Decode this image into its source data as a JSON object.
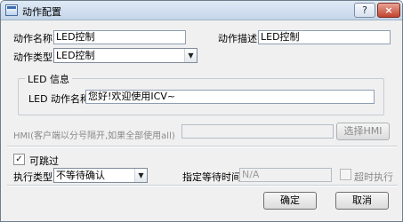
{
  "window": {
    "title": "动作配置",
    "help_label": "?",
    "close_label": "×"
  },
  "form": {
    "action_name_label": "动作名称",
    "action_name_value": "LED控制",
    "action_desc_label": "动作描述",
    "action_desc_value": "LED控制",
    "action_type_label": "动作类型",
    "action_type_value": "LED控制"
  },
  "led_group": {
    "title": "LED 信息",
    "name_label": "LED 动作名称",
    "name_value": "您好!欢迎使用ICV~"
  },
  "hmi": {
    "label": "HMI(客户端以分号隔开,如果全部使用all)",
    "value": "",
    "select_button": "选择HMI"
  },
  "options": {
    "skippable_label": "可跳过",
    "skippable_checked": true,
    "exec_type_label": "执行类型",
    "exec_type_value": "不等待确认",
    "wait_time_label": "指定等待时间",
    "wait_time_value": "N/A",
    "timeout_exec_label": "超时执行",
    "timeout_exec_checked": false
  },
  "actions": {
    "ok_label": "确定",
    "cancel_label": "取消"
  }
}
